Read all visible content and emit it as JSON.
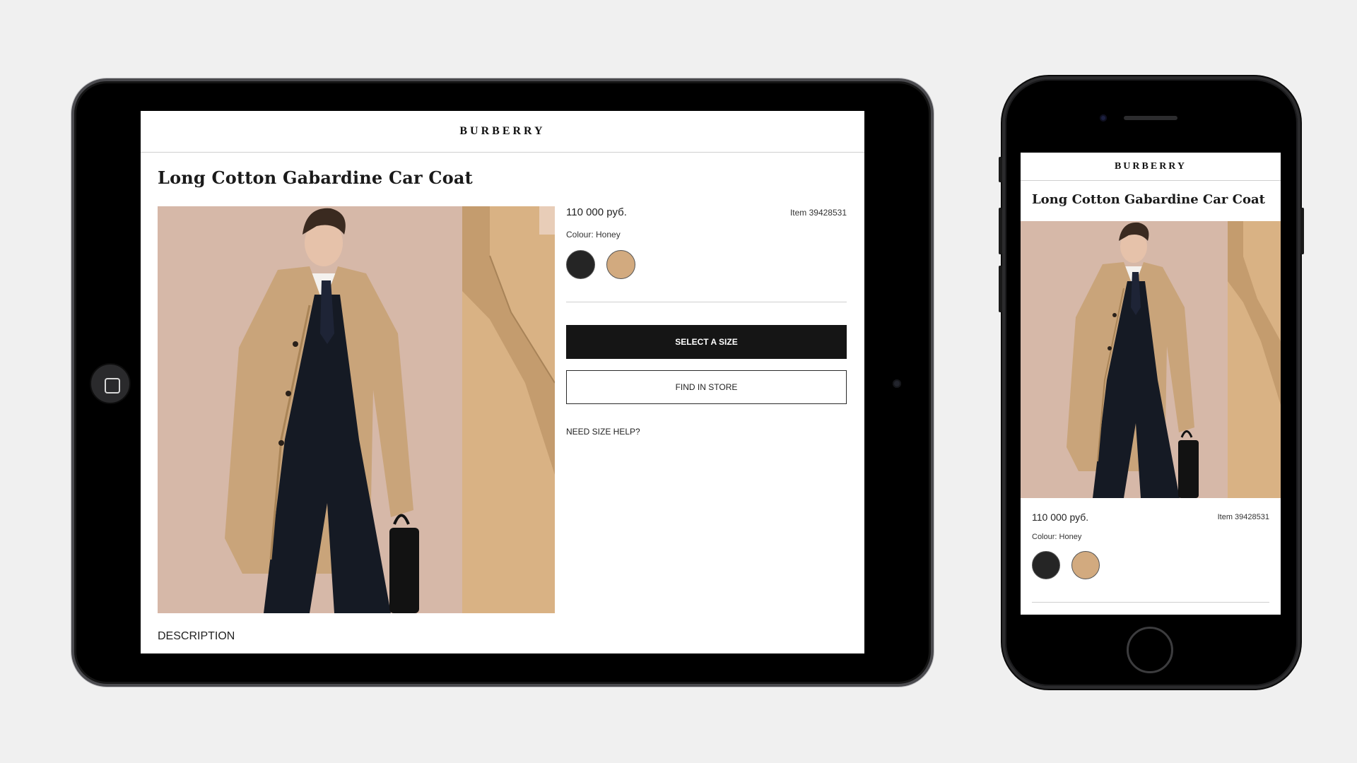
{
  "brand": {
    "logo_text": "BURBERRY"
  },
  "product": {
    "title": "Long Cotton Gabardine Car Coat",
    "price": "110 000 руб.",
    "item_number": "Item 39428531",
    "colour_label": "Colour: Honey",
    "swatches": [
      {
        "name": "black",
        "color": "#252525"
      },
      {
        "name": "honey",
        "color": "#d2aa7f"
      }
    ],
    "image": "model-in-honey-trench-coat"
  },
  "actions": {
    "select_size": "SELECT A SIZE",
    "find_in_store": "FIND IN STORE",
    "size_help": "NEED SIZE HELP?"
  },
  "sections": {
    "description": "DESCRIPTION"
  },
  "colors": {
    "page_background": "#f0f0f0",
    "image_background": "#d6b8a8",
    "coat": "#c9a47a",
    "suit": "#151a24",
    "primary_button": "#151515"
  }
}
